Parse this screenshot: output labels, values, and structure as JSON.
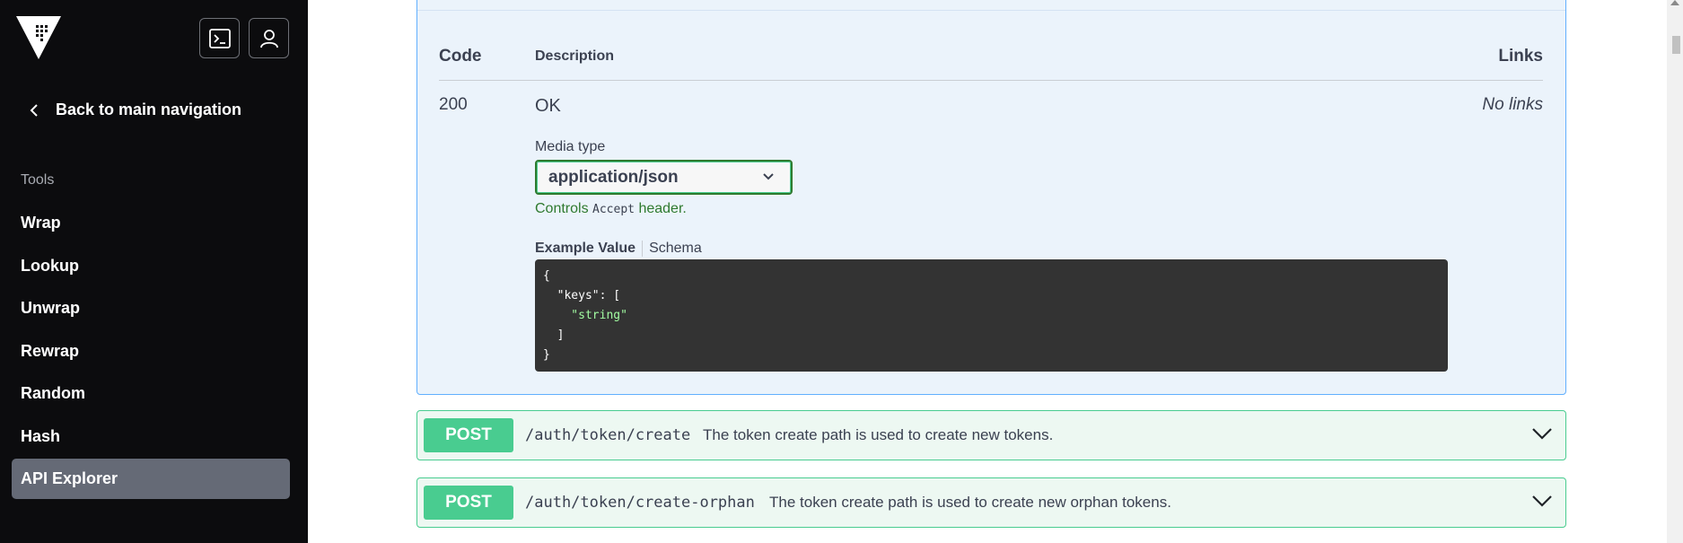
{
  "sidebar": {
    "back_label": "Back to main navigation",
    "section_label": "Tools",
    "items": [
      {
        "label": "Wrap"
      },
      {
        "label": "Lookup"
      },
      {
        "label": "Unwrap"
      },
      {
        "label": "Rewrap"
      },
      {
        "label": "Random"
      },
      {
        "label": "Hash"
      },
      {
        "label": "API Explorer",
        "active": true
      }
    ]
  },
  "response": {
    "headers": {
      "code": "Code",
      "description": "Description",
      "links": "Links"
    },
    "row": {
      "code": "200",
      "description": "OK",
      "links": "No links",
      "media_type_label": "Media type",
      "media_type_value": "application/json",
      "controls_prefix": "Controls",
      "controls_code": "Accept",
      "controls_suffix": "header.",
      "example_tab": "Example Value",
      "schema_tab": "Schema",
      "example_lines": [
        "{",
        "  \"keys\": [",
        "    \"string\"",
        "  ]",
        "}"
      ]
    }
  },
  "operations": [
    {
      "method": "POST",
      "path": "/auth/token/create",
      "summary": "The token create path is used to create new tokens."
    },
    {
      "method": "POST",
      "path": "/auth/token/create-orphan",
      "summary": "The token create path is used to create new orphan tokens."
    }
  ],
  "colors": {
    "sidebar_bg": "#0c0c0e",
    "active_item": "#656a76",
    "post_method": "#49cc90",
    "post_bg": "#edf8f2",
    "get_bg": "#ebf3fb",
    "code_bg": "#333333"
  },
  "icons": [
    "vault-logo-icon",
    "terminal-icon",
    "user-icon",
    "chevron-left-icon",
    "chevron-down-icon"
  ]
}
